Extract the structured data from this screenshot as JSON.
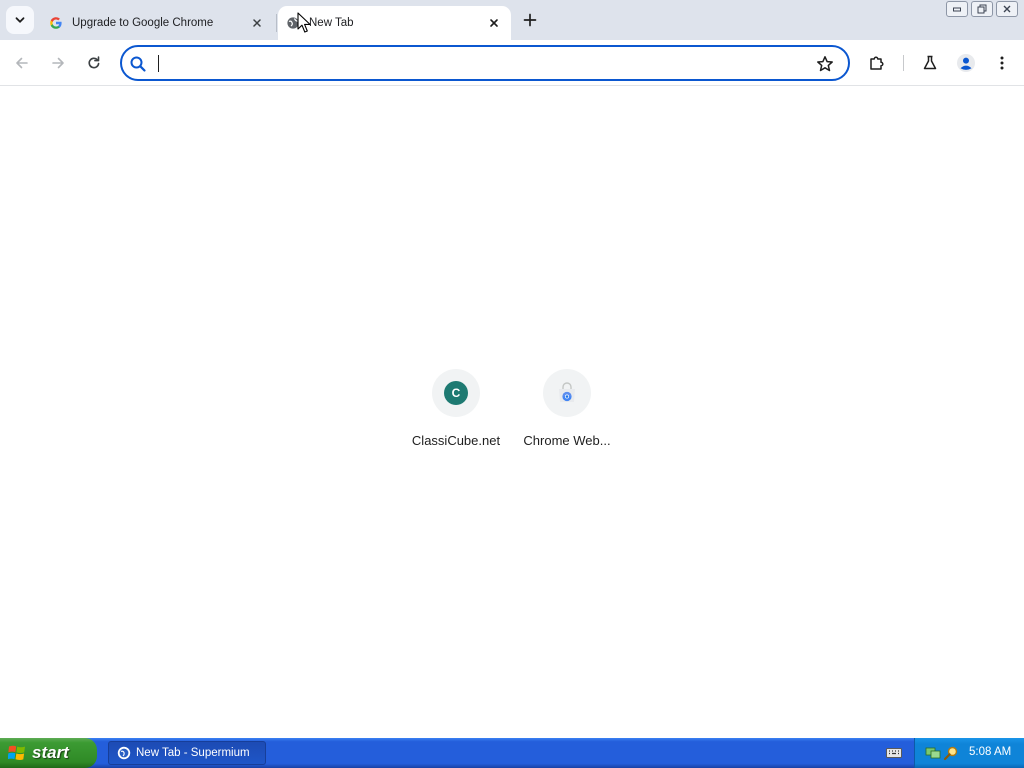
{
  "browser": {
    "tabs": [
      {
        "title": "Upgrade to Google Chrome",
        "favicon": "google-g-icon",
        "active": false
      },
      {
        "title": "New Tab",
        "favicon": "globe-icon",
        "active": true
      }
    ],
    "omnibox": {
      "value": "",
      "placeholder": ""
    }
  },
  "new_tab": {
    "shortcuts": [
      {
        "label": "ClassiCube.net",
        "icon": "classicube-c-icon",
        "initial": "C"
      },
      {
        "label": "Chrome Web...",
        "icon": "chrome-web-store-icon"
      }
    ]
  },
  "taskbar": {
    "start_label": "start",
    "task_item_label": "New Tab - Supermium",
    "clock": "5:08 AM"
  },
  "colors": {
    "tabstrip_bg": "#dee3ec",
    "omnibox_focus": "#0b57d0",
    "classicube_avatar": "#1e7a72",
    "taskbar_blue": "#245edb",
    "start_green": "#3c9b33",
    "tray_blue": "#0f84d8"
  }
}
